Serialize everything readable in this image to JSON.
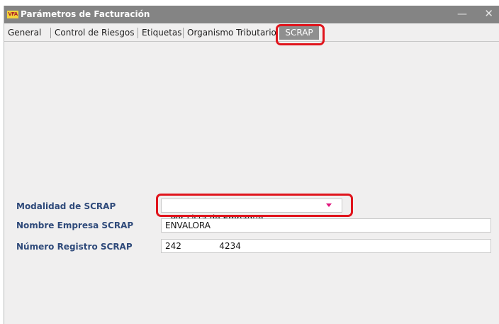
{
  "window": {
    "icon_text": "VFA",
    "title": "Parámetros de Facturación",
    "minimize_glyph": "—",
    "close_glyph": "✕"
  },
  "tabs": [
    {
      "label": "General"
    },
    {
      "label": "Control de Riesgos"
    },
    {
      "label": "Etiquetas"
    },
    {
      "label": "Organismo Tributario"
    },
    {
      "label": "SCRAP",
      "active": true
    }
  ],
  "form": {
    "modalidad": {
      "label": "Modalidad de SCRAP",
      "value": "Por Lista de Empaque"
    },
    "nombre_empresa": {
      "label": "Nombre Empresa SCRAP",
      "value": "ENVALORA"
    },
    "numero_registro": {
      "label": "Número Registro SCRAP",
      "value": "242              4234"
    }
  },
  "colors": {
    "titlebar": "#848484",
    "active_tab": "#8f8f8f",
    "highlight": "#e0141c",
    "label_text": "#2f4a7a",
    "dropdown_arrow": "#e0147c"
  }
}
